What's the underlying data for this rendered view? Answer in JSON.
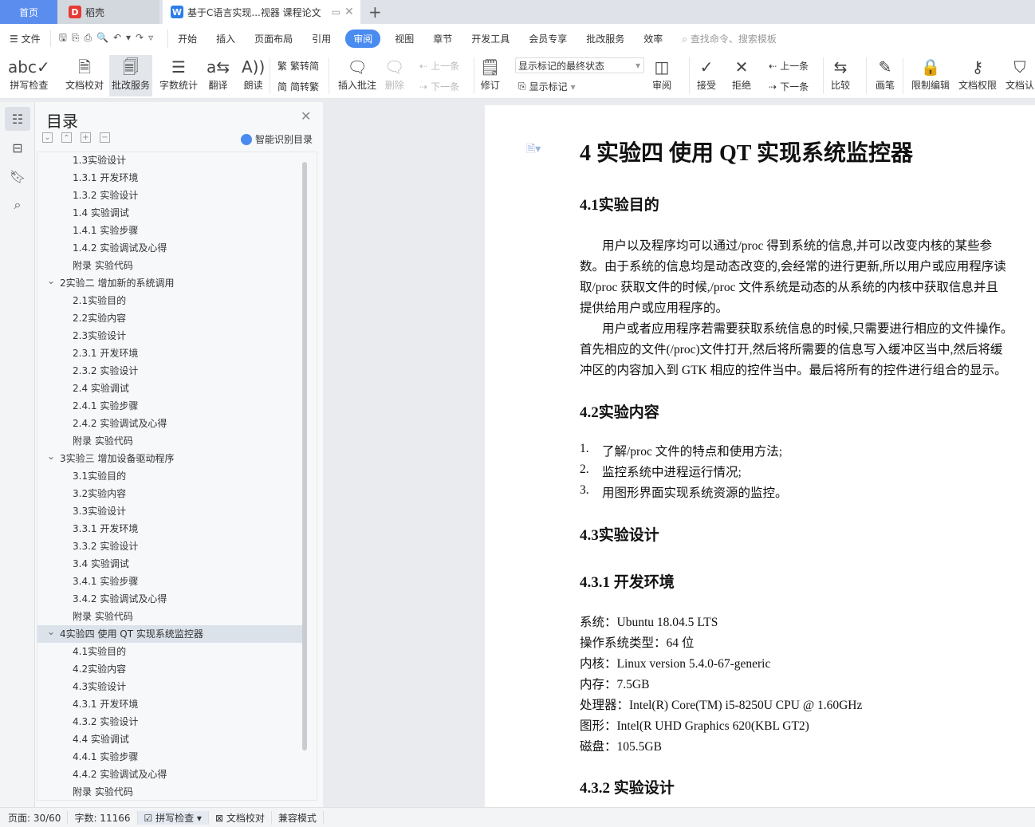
{
  "tabs": {
    "home": "首页",
    "daoke": "稻壳",
    "doc": "基于C语言实现...视器 课程论文",
    "new_tab": "+"
  },
  "colors": {
    "accent": "#4a8bf0",
    "home_tab": "#5b8def",
    "daoke": "#e53935",
    "wps": "#2b7de9"
  },
  "menu": {
    "file": "文件",
    "items": [
      "开始",
      "插入",
      "页面布局",
      "引用",
      "审阅",
      "视图",
      "章节",
      "开发工具",
      "会员专享",
      "批改服务",
      "效率"
    ],
    "active": "审阅",
    "search_placeholder": "查找命令、搜索模板"
  },
  "ribbon": {
    "spell": "拼写检查",
    "proof": "文档校对",
    "correct": "批改服务",
    "count": "字数统计",
    "translate": "翻译",
    "read": "朗读",
    "t2s": "繁转简",
    "s2t": "简转繁",
    "insert_comment": "插入批注",
    "delete": "删除",
    "prev": "上一条",
    "next": "下一条",
    "revise": "修订",
    "markup_state": "显示标记的最终状态",
    "show_markup": "显示标记",
    "review": "审阅",
    "accept": "接受",
    "reject": "拒绝",
    "prev2": "上一条",
    "next2": "下一条",
    "compare": "比较",
    "pen": "画笔",
    "restrict": "限制编辑",
    "permission": "文档权限",
    "certify": "文档认"
  },
  "toc": {
    "title": "目录",
    "smart": "智能识别目录",
    "items": [
      {
        "t": "1.3实验设计",
        "l": 2
      },
      {
        "t": "1.3.1  开发环境",
        "l": 2
      },
      {
        "t": "1.3.2  实验设计",
        "l": 2
      },
      {
        "t": "1.4  实验调试",
        "l": 2
      },
      {
        "t": "1.4.1  实验步骤",
        "l": 2
      },
      {
        "t": "1.4.2  实验调试及心得",
        "l": 2
      },
      {
        "t": "附录  实验代码",
        "l": 2
      },
      {
        "t": "2实验二  增加新的系统调用",
        "l": 1
      },
      {
        "t": "2.1实验目的",
        "l": 2
      },
      {
        "t": "2.2实验内容",
        "l": 2
      },
      {
        "t": "2.3实验设计",
        "l": 2
      },
      {
        "t": "2.3.1  开发环境",
        "l": 2
      },
      {
        "t": "2.3.2  实验设计",
        "l": 2
      },
      {
        "t": "2.4  实验调试",
        "l": 2
      },
      {
        "t": "2.4.1  实验步骤",
        "l": 2
      },
      {
        "t": "2.4.2  实验调试及心得",
        "l": 2
      },
      {
        "t": "附录  实验代码",
        "l": 2
      },
      {
        "t": "3实验三  增加设备驱动程序",
        "l": 1
      },
      {
        "t": "3.1实验目的",
        "l": 2
      },
      {
        "t": "3.2实验内容",
        "l": 2
      },
      {
        "t": "3.3实验设计",
        "l": 2
      },
      {
        "t": "3.3.1  开发环境",
        "l": 2
      },
      {
        "t": "3.3.2  实验设计",
        "l": 2
      },
      {
        "t": "3.4  实验调试",
        "l": 2
      },
      {
        "t": "3.4.1  实验步骤",
        "l": 2
      },
      {
        "t": "3.4.2  实验调试及心得",
        "l": 2
      },
      {
        "t": "附录  实验代码",
        "l": 2
      },
      {
        "t": "4实验四  使用 QT 实现系统监控器",
        "l": 1,
        "selected": true
      },
      {
        "t": "4.1实验目的",
        "l": 2
      },
      {
        "t": "4.2实验内容",
        "l": 2
      },
      {
        "t": "4.3实验设计",
        "l": 2
      },
      {
        "t": "4.3.1  开发环境",
        "l": 2
      },
      {
        "t": "4.3.2  实验设计",
        "l": 2
      },
      {
        "t": "4.4  实验调试",
        "l": 2
      },
      {
        "t": "4.4.1  实验步骤",
        "l": 2
      },
      {
        "t": "4.4.2  实验调试及心得",
        "l": 2
      },
      {
        "t": "附录  实验代码",
        "l": 2
      }
    ]
  },
  "doc": {
    "h1": "4  实验四  使用 QT 实现系统监控器",
    "h41": "4.1实验目的",
    "p1": [
      "用户以及程序均可以通过/proc 得到系统的信息,并可以改变内核的某些参",
      "数。由于系统的信息均是动态改变的,会经常的进行更新,所以用户或应用程序读",
      "取/proc 获取文件的时候,/proc 文件系统是动态的从系统的内核中获取信息并且",
      "提供给用户或应用程序的。"
    ],
    "p2": [
      "用户或者应用程序若需要获取系统信息的时候,只需要进行相应的文件操作。",
      "首先相应的文件(/proc)文件打开,然后将所需要的信息写入缓冲区当中,然后将缓",
      "冲区的内容加入到  GTK  相应的控件当中。最后将所有的控件进行组合的显示。"
    ],
    "h42": "4.2实验内容",
    "list": [
      {
        "n": "1.",
        "t": "了解/proc 文件的特点和使用方法;"
      },
      {
        "n": "2.",
        "t": "监控系统中进程运行情况;"
      },
      {
        "n": "3.",
        "t": "用图形界面实现系统资源的监控。"
      }
    ],
    "h43": "4.3实验设计",
    "h431": "4.3.1   开发环境",
    "env": [
      "系统：Ubuntu 18.04.5 LTS",
      "操作系统类型：64 位",
      "内核：Linux version 5.4.0-67-generic",
      "内存：7.5GB",
      "处理器：Intel(R) Core(TM) i5-8250U CPU @ 1.60GHz",
      "图形：Intel(R UHD Graphics 620(KBL GT2)",
      "磁盘：105.5GB"
    ],
    "h432": "4.3.2   实验设计"
  },
  "status": {
    "page": "页面: 30/60",
    "words": "字数: 11166",
    "spell": "拼写检查",
    "proof": "文档校对",
    "compat": "兼容模式"
  }
}
